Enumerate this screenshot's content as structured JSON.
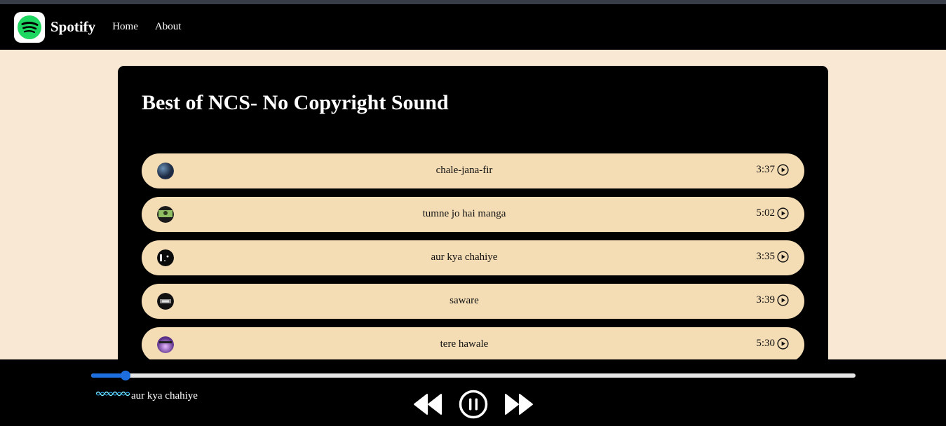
{
  "nav": {
    "brand": "Spotify",
    "links": [
      "Home",
      "About"
    ]
  },
  "playlist": {
    "title": "Best of NCS- No Copyright Sound",
    "songs": [
      {
        "name": "chale-jana-fir",
        "duration": "3:37"
      },
      {
        "name": "tumne jo hai manga",
        "duration": "5:02"
      },
      {
        "name": "aur kya chahiye",
        "duration": "3:35"
      },
      {
        "name": "saware",
        "duration": "3:39"
      },
      {
        "name": "tere hawale",
        "duration": "5:30"
      }
    ]
  },
  "player": {
    "now_playing": "aur kya chahiye",
    "progress_fraction": 0.045,
    "state": "playing"
  },
  "icons": {
    "logo": "spotify-logo-icon",
    "play": "play-circle-icon",
    "previous": "previous-icon",
    "pause": "pause-circle-icon",
    "next": "next-icon",
    "wave": "equalizer-wave-icon"
  },
  "colors": {
    "page_bg": "#f9e8d4",
    "panel_bg": "#000000",
    "song_bg": "#f4dcb4",
    "accent": "#1d6fe0",
    "spotify_green": "#1ed760"
  }
}
